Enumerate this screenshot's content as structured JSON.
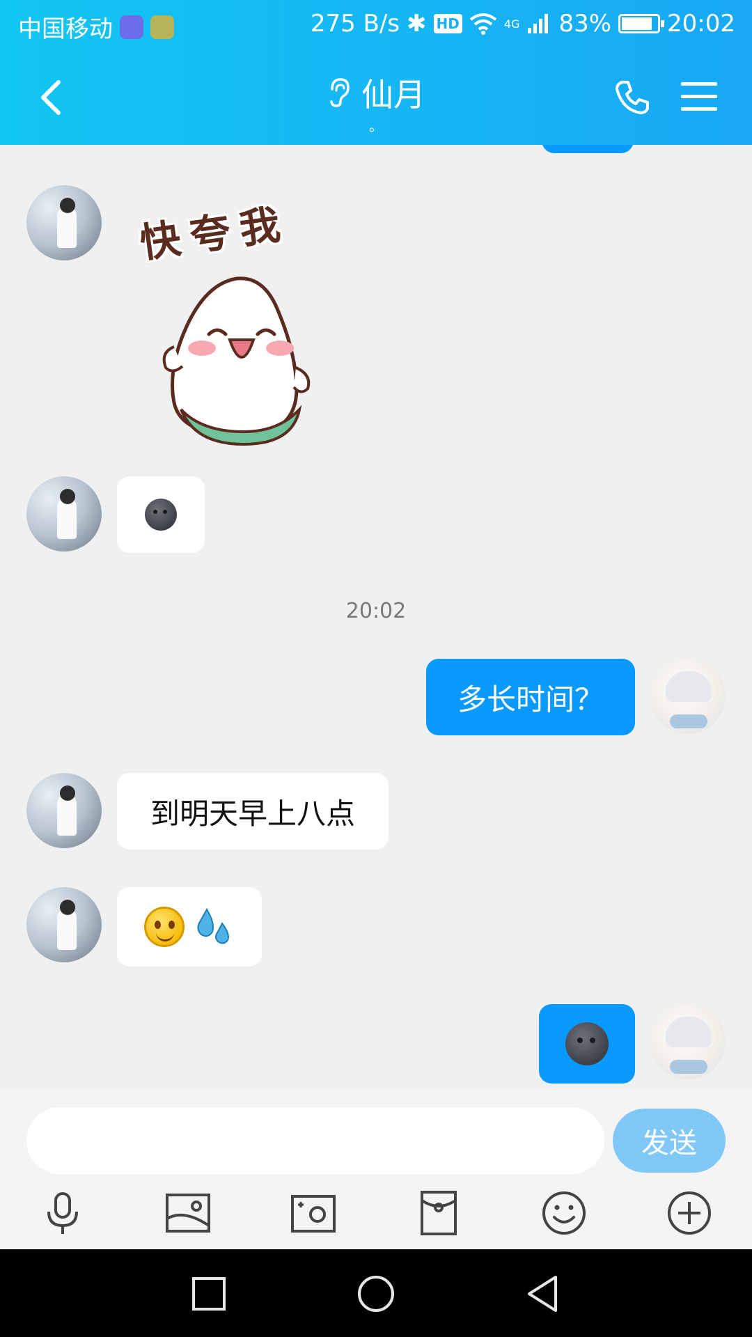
{
  "status_bar": {
    "carrier": "中国移动",
    "net_speed": "275 B/s",
    "hd": "HD",
    "network": "4G",
    "battery": "83%",
    "battery_level": 0.83,
    "time": "20:02"
  },
  "header": {
    "title": "仙月",
    "subtitle": "。"
  },
  "chat": {
    "sticker_text": "快夸我",
    "timestamp": "20:02",
    "messages": [
      {
        "from": "other",
        "type": "sticker"
      },
      {
        "from": "other",
        "type": "emoji",
        "emoji": "new-moon-face"
      },
      {
        "from": "me",
        "type": "text",
        "text": "多长时间？"
      },
      {
        "from": "other",
        "type": "text",
        "text": "到明天早上八点"
      },
      {
        "from": "other",
        "type": "emoji",
        "emoji": "smile-sweat"
      },
      {
        "from": "me",
        "type": "emoji",
        "emoji": "new-moon-face"
      }
    ]
  },
  "input": {
    "value": "",
    "placeholder": "",
    "send_label": "发送"
  },
  "colors": {
    "header_start": "#12c6f2",
    "header_end": "#19a8f5",
    "bubble_out": "#0a99ff",
    "send_button": "#7fc8f7"
  }
}
